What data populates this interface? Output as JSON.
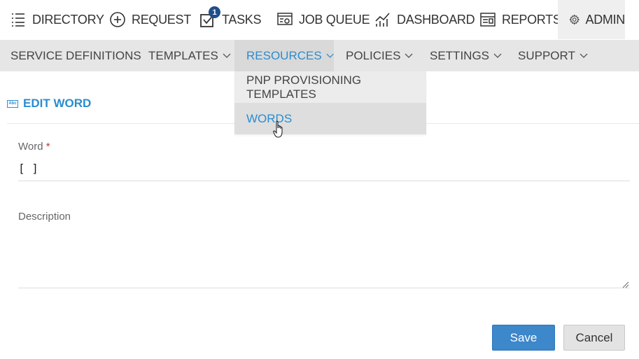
{
  "top_nav": {
    "directory": "DIRECTORY",
    "request": "REQUEST",
    "tasks": "TASKS",
    "tasks_badge": "1",
    "job_queue": "JOB QUEUE",
    "dashboard": "DASHBOARD",
    "reports": "REPORTS",
    "admin": "ADMIN"
  },
  "sub_nav": {
    "service_definitions": "SERVICE DEFINITIONS",
    "templates": "TEMPLATES",
    "resources": "RESOURCES",
    "policies": "POLICIES",
    "settings": "SETTINGS",
    "support": "SUPPORT"
  },
  "dropdown": {
    "items": [
      "PNP PROVISIONING TEMPLATES",
      "WORDS"
    ]
  },
  "page": {
    "icon_text": "Abc",
    "title": "EDIT WORD"
  },
  "form": {
    "word_label": "Word",
    "required_mark": "*",
    "word_value": "[ ]",
    "description_label": "Description",
    "description_value": ""
  },
  "actions": {
    "save_label": "Save",
    "cancel_label": "Cancel"
  },
  "colors": {
    "accent": "#2a8dd0",
    "save_bg": "#3d87cb",
    "badge": "#1f4e8c"
  }
}
